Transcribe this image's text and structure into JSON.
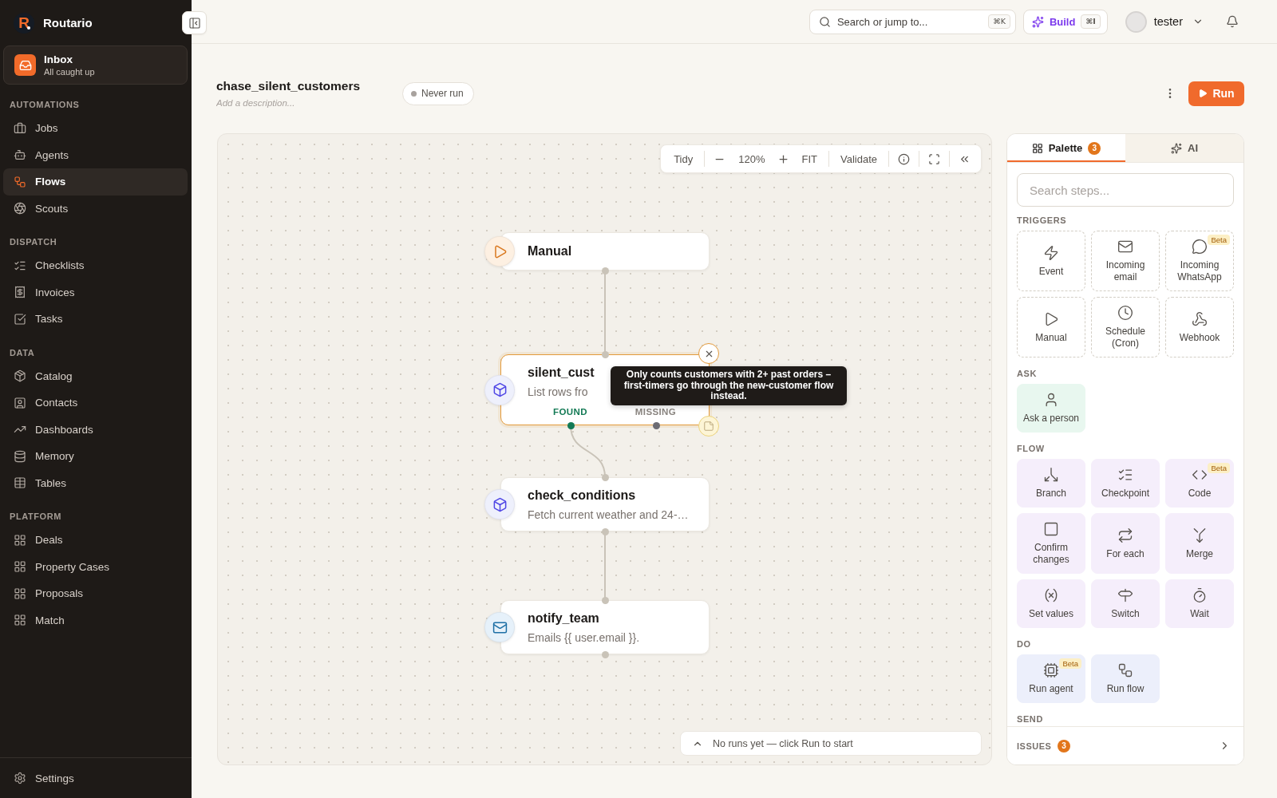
{
  "sidebar": {
    "logo_mark": "R",
    "brand": "Routario",
    "inbox": {
      "title": "Inbox",
      "subtitle": "All caught up"
    },
    "sections": [
      {
        "heading": "AUTOMATIONS",
        "items": [
          {
            "label": "Jobs",
            "selected": false
          },
          {
            "label": "Agents",
            "selected": false
          },
          {
            "label": "Flows",
            "selected": true
          },
          {
            "label": "Scouts",
            "selected": false
          }
        ]
      },
      {
        "heading": "DISPATCH",
        "items": [
          {
            "label": "Checklists",
            "selected": false
          },
          {
            "label": "Invoices",
            "selected": false
          },
          {
            "label": "Tasks",
            "selected": false
          }
        ]
      },
      {
        "heading": "DATA",
        "items": [
          {
            "label": "Catalog",
            "selected": false
          },
          {
            "label": "Contacts",
            "selected": false
          },
          {
            "label": "Dashboards",
            "selected": false
          },
          {
            "label": "Memory",
            "selected": false
          },
          {
            "label": "Tables",
            "selected": false
          }
        ]
      },
      {
        "heading": "PLATFORM",
        "items": [
          {
            "label": "Deals",
            "selected": false
          },
          {
            "label": "Property Cases",
            "selected": false
          },
          {
            "label": "Proposals",
            "selected": false
          },
          {
            "label": "Match",
            "selected": false
          }
        ]
      }
    ],
    "settings": {
      "label": "Settings"
    }
  },
  "topbar": {
    "search": {
      "placeholder": "Search or jump to...",
      "shortcut": "⌘K"
    },
    "build": {
      "label": "Build",
      "shortcut": "⌘I"
    },
    "user": {
      "name": "tester"
    }
  },
  "flow": {
    "title": "chase_silent_customers",
    "description": {
      "placeholder": "Add a description..."
    },
    "status": {
      "label": "Never run"
    },
    "run_button": {
      "label": "Run"
    }
  },
  "canvas": {
    "toolbar": {
      "tidy": "Tidy",
      "zoom_level": "120%",
      "fit": "FIT",
      "validate": "Validate"
    },
    "nodes": [
      {
        "kind": "trigger",
        "title": "Manual",
        "selected": false
      },
      {
        "kind": "step",
        "title": "silent_cust",
        "description": "List rows fro",
        "selected": true,
        "note": "Only counts customers with 2+ past orders – first-timers go through the new-customer flow instead.",
        "outputs": [
          {
            "label": "FOUND",
            "connected": true
          },
          {
            "label": "MISSING",
            "connected": false
          }
        ]
      },
      {
        "kind": "step",
        "title": "check_conditions",
        "description": "Fetch current weather and 24-…",
        "selected": false
      },
      {
        "kind": "email",
        "title": "notify_team",
        "description": "Emails {{ user.email }}.",
        "selected": false
      }
    ],
    "run_status": "No runs yet — click Run to start"
  },
  "palette": {
    "tabs": [
      {
        "label": "Palette",
        "badge": "3",
        "selected": true
      },
      {
        "label": "AI",
        "selected": false
      }
    ],
    "search": {
      "placeholder": "Search steps..."
    },
    "groups": [
      {
        "kind": "trigger",
        "heading": "TRIGGERS",
        "items": [
          {
            "label": "Event"
          },
          {
            "label": "Incoming email"
          },
          {
            "label": "Incoming WhatsApp",
            "badge": "Beta"
          },
          {
            "label": "Manual"
          },
          {
            "label": "Schedule (Cron)"
          },
          {
            "label": "Webhook"
          }
        ]
      },
      {
        "kind": "ask",
        "heading": "ASK",
        "items": [
          {
            "label": "Ask a person"
          }
        ]
      },
      {
        "kind": "flow",
        "heading": "FLOW",
        "items": [
          {
            "label": "Branch"
          },
          {
            "label": "Checkpoint"
          },
          {
            "label": "Code",
            "badge": "Beta"
          },
          {
            "label": "Confirm changes"
          },
          {
            "label": "For each"
          },
          {
            "label": "Merge"
          },
          {
            "label": "Set values"
          },
          {
            "label": "Switch"
          },
          {
            "label": "Wait"
          }
        ]
      },
      {
        "kind": "do",
        "heading": "DO",
        "items": [
          {
            "label": "Run agent",
            "badge": "Beta"
          },
          {
            "label": "Run flow"
          }
        ]
      },
      {
        "kind": "send",
        "heading": "SEND"
      }
    ],
    "issues": {
      "label": "ISSUES",
      "count": "3"
    }
  }
}
